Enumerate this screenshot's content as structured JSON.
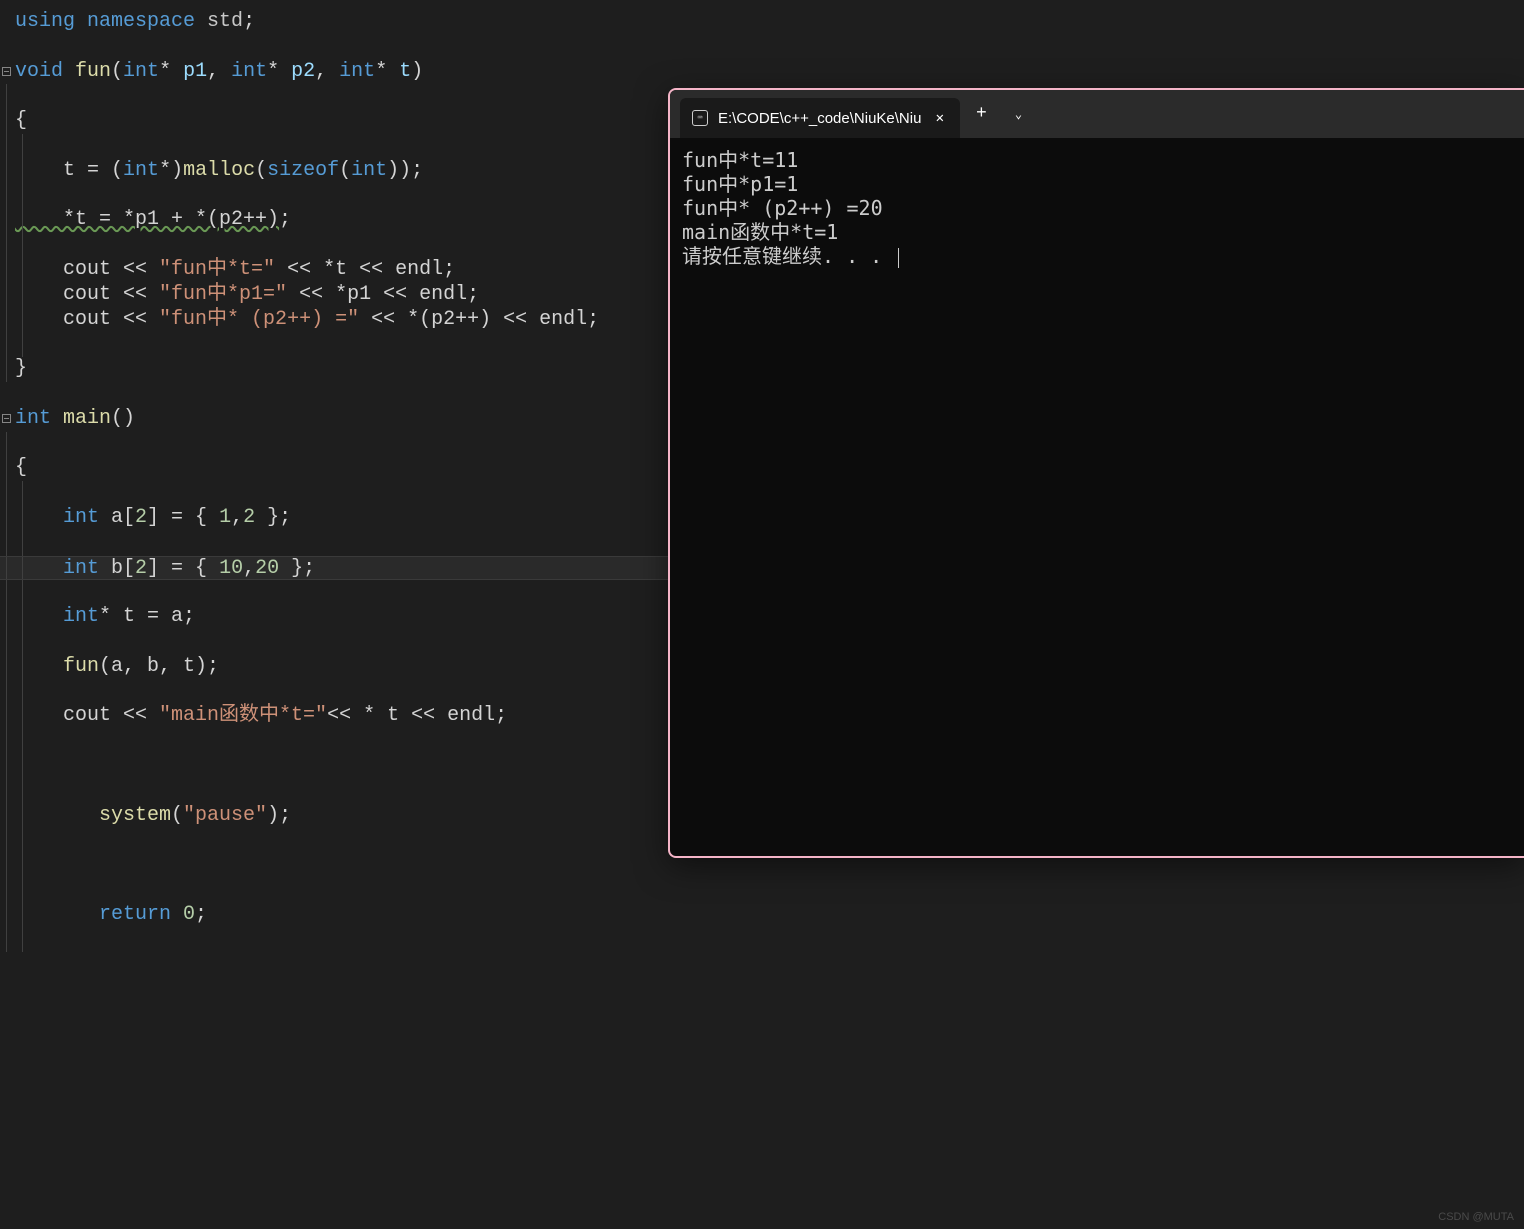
{
  "editor": {
    "lines": {
      "l1_using": "using",
      "l1_namespace": " namespace",
      "l1_std": " std",
      "l1_semi": ";",
      "l3_void": "void",
      "l3_fun": " fun",
      "l3_paren1": "(",
      "l3_int1": "int",
      "l3_star1": "* ",
      "l3_p1": "p1",
      "l3_comma1": ", ",
      "l3_int2": "int",
      "l3_star2": "* ",
      "l3_p2": "p2",
      "l3_comma2": ", ",
      "l3_int3": "int",
      "l3_star3": "* ",
      "l3_t": "t",
      "l3_paren2": ")",
      "l5_brace": "{",
      "l7_t": "    t ",
      "l7_eq": "= ",
      "l7_paren1": "(",
      "l7_int": "int",
      "l7_star": "*)",
      "l7_malloc": "malloc",
      "l7_paren2": "(",
      "l7_sizeof": "sizeof",
      "l7_paren3": "(",
      "l7_int2": "int",
      "l7_paren4": "));",
      "l9_expr": "    *t = *p1 + *(p2++)",
      "l9_semi": ";",
      "l11_cout": "    cout ",
      "l11_op1": "<< ",
      "l11_str": "\"fun中*t=\"",
      "l11_op2": " << ",
      "l11_star": "*",
      "l11_t": "t ",
      "l11_op3": "<< ",
      "l11_endl": "endl",
      "l11_semi": ";",
      "l12_cout": "    cout ",
      "l12_op1": "<< ",
      "l12_str": "\"fun中*p1=\"",
      "l12_op2": " << ",
      "l12_star": "*",
      "l12_p1": "p1 ",
      "l12_op3": "<< ",
      "l12_endl": "endl",
      "l12_semi": ";",
      "l13_cout": "    cout ",
      "l13_op1": "<< ",
      "l13_str": "\"fun中* (p2++) =\"",
      "l13_op2": " << ",
      "l13_star": "*",
      "l13_p2": "(p2++) ",
      "l13_op3": "<< ",
      "l13_endl": "endl",
      "l13_semi": ";",
      "l15_brace": "}",
      "l17_int": "int",
      "l17_main": " main",
      "l17_parens": "()",
      "l19_brace": "{",
      "l21_int": "    int",
      "l21_a": " a[",
      "l21_2": "2",
      "l21_br": "] = { ",
      "l21_1": "1",
      "l21_c": ",",
      "l21_2b": "2",
      "l21_end": " };",
      "l23_int": "    int",
      "l23_b": " b[",
      "l23_2": "2",
      "l23_br": "] = { ",
      "l23_10": "10",
      "l23_c": ",",
      "l23_20": "20",
      "l23_end": " };",
      "l25_int": "    int",
      "l25_star": "* ",
      "l25_t": "t = a;",
      "l27_fun": "    fun",
      "l27_args": "(a, b, t);",
      "l29_cout": "    cout ",
      "l29_op1": "<< ",
      "l29_str": "\"main函数中*t=\"",
      "l29_op2": "<< * ",
      "l29_t": "t ",
      "l29_op3": "<< ",
      "l29_endl": "endl",
      "l29_semi": ";",
      "l33_system": "       system",
      "l33_paren1": "(",
      "l33_str": "\"pause\"",
      "l33_paren2": ");",
      "l37_return": "       return",
      "l37_0": " 0",
      "l37_semi": ";"
    }
  },
  "terminal": {
    "tabTitle": "E:\\CODE\\c++_code\\NiuKe\\Niu",
    "output": [
      "fun中*t=11",
      "fun中*p1=1",
      "fun中* (p2++) =20",
      "main函数中*t=1",
      "请按任意键继续. . . "
    ]
  },
  "watermark": "CSDN @MUTA️"
}
